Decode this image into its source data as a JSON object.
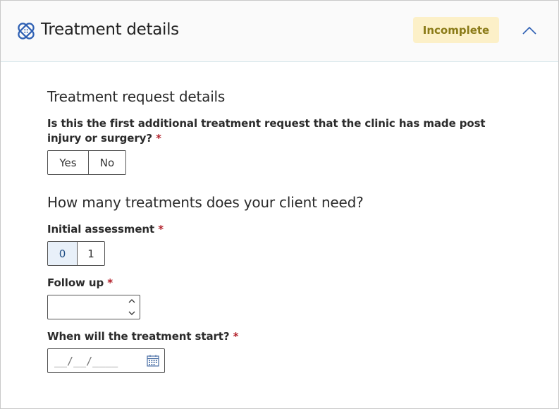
{
  "header": {
    "title": "Treatment details",
    "status_badge": "Incomplete",
    "logo_icon": "cross-medical-icon",
    "collapse_icon": "chevron-up-icon",
    "colors": {
      "badge_bg": "#fcf0c8",
      "badge_text": "#8a7a17",
      "logo": "#2d5fb3"
    }
  },
  "request_section": {
    "title": "Treatment request details",
    "question": "Is this the first additional treatment request that the clinic has made post injury or surgery?",
    "required_mark": "*",
    "options": [
      "Yes",
      "No"
    ],
    "selected": null
  },
  "treatments_section": {
    "title": "How many treatments does your client need?",
    "initial_assessment": {
      "label": "Initial assessment",
      "required_mark": "*",
      "options": [
        "0",
        "1"
      ],
      "selected": "0"
    },
    "follow_up": {
      "label": "Follow up",
      "required_mark": "*",
      "value": ""
    },
    "start_date": {
      "label": "When will the treatment start?",
      "required_mark": "*",
      "placeholder": "__/__/____",
      "icon": "calendar-icon"
    }
  }
}
